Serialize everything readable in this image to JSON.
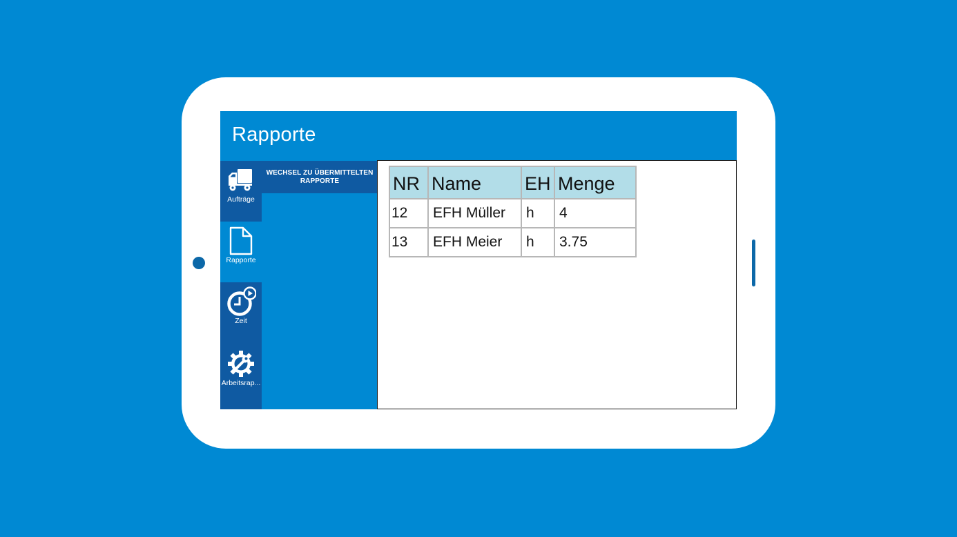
{
  "appbar": {
    "title": "Rapporte"
  },
  "nav": {
    "items": [
      {
        "label": "Aufträge",
        "icon": "truck-icon",
        "active": false
      },
      {
        "label": "Rapporte",
        "icon": "document-icon",
        "active": true
      },
      {
        "label": "Zeit",
        "icon": "clock-play-icon",
        "active": false
      },
      {
        "label": "Arbeitsrap...",
        "icon": "gear-wrench-icon",
        "active": false
      }
    ]
  },
  "list_pane": {
    "switch_button_label": "WECHSEL ZU ÜBERMITTELTEN RAPPORTE"
  },
  "table": {
    "headers": [
      "NR",
      "Name",
      "EH",
      "Menge"
    ],
    "rows": [
      [
        "12",
        "EFH Müller",
        "h",
        "4"
      ],
      [
        "13",
        "EFH Meier",
        "h",
        "3.75"
      ]
    ]
  },
  "colors": {
    "background": "#0089d3",
    "nav_rail": "#0f5aa2",
    "table_header": "#b2dde8",
    "device_accent": "#0c68a8"
  }
}
